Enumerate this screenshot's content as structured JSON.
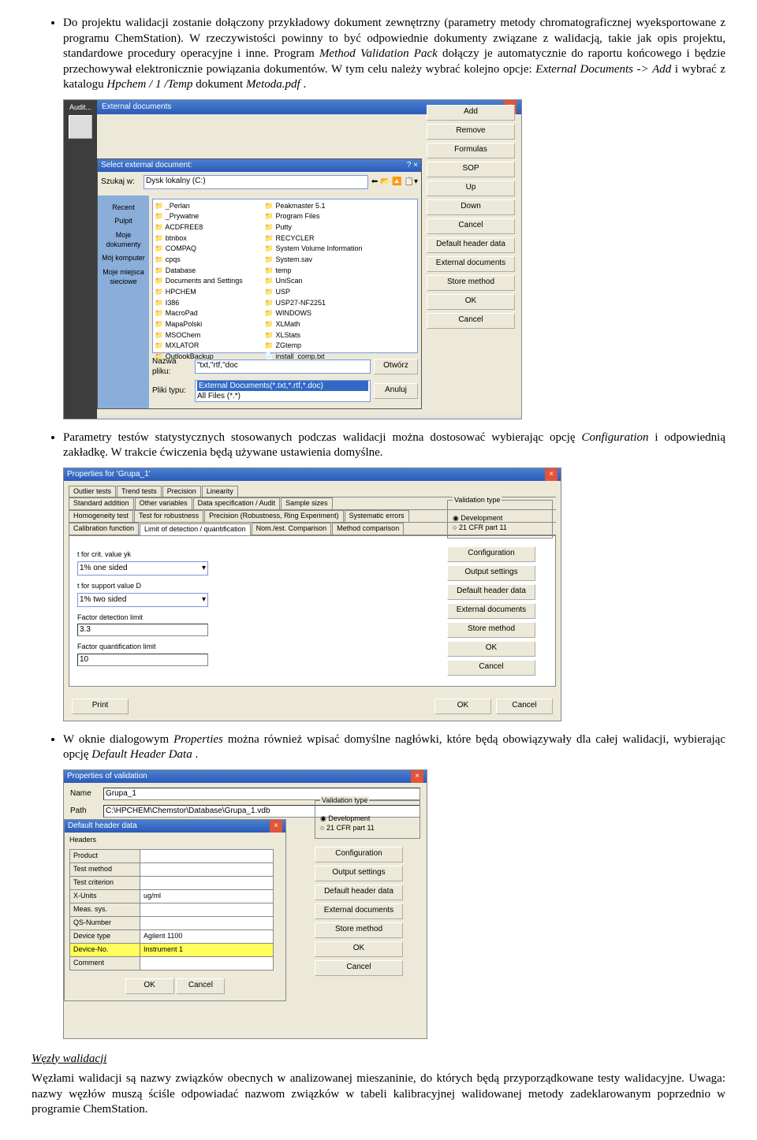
{
  "bullets": {
    "b1_part1": "Do projektu walidacji zostanie dołączony przykładowy dokument zewnętrzny (parametry metody chromatograficznej wyeksportowane z programu ChemStation). W rzeczywistości powinny to być odpowiednie dokumenty związane z walidacją, takie jak opis projektu, standardowe procedury operacyjne i inne. Program ",
    "b1_italic1": "Method Validation Pack",
    "b1_part2": " dołączy je automatycznie do raportu końcowego i będzie przechowywał elektronicznie powiązania dokumentów. W tym celu należy wybrać kolejno opcje: ",
    "b1_italic2": "External Documents -> Add",
    "b1_part3": " i wybrać z katalogu ",
    "b1_italic3": "Hpchem / 1 /Temp",
    "b1_part4": " dokument ",
    "b1_italic4": "Metoda.pdf",
    "b1_part5": ".",
    "b2_part1": "Parametry testów statystycznych stosowanych podczas walidacji można dostosować wybierając opcję ",
    "b2_italic1": "Configuration",
    "b2_part2": " i odpowiednią zakładkę. W trakcie ćwiczenia będą używane ustawienia domyślne.",
    "b3_part1": "W oknie dialogowym ",
    "b3_italic1": "Properties",
    "b3_part2": " można również wpisać domyślne nagłówki, które będą obowiązywały dla całej walidacji, wybierając opcję ",
    "b3_italic2": "Default Header Data",
    "b3_part3": "."
  },
  "section_title": "Węzły walidacji",
  "para": "Węzłami walidacji są nazwy związków obecnych w analizowanej mieszaninie, do których będą przyporządkowane testy walidacyjne. Uwaga: nazwy węzłów muszą ściśle odpowiadać nazwom związków w tabeli kalibracyjnej walidowanej metody zadeklarowanym poprzednio w programie ChemStation.",
  "ss1": {
    "audit_label": "Audit...",
    "ext_title": "External documents",
    "buttons": [
      "Add",
      "Remove",
      "Formulas",
      "SOP",
      "Up",
      "Down",
      "Cancel",
      "Default header data",
      "External documents",
      "Store method",
      "OK",
      "Cancel"
    ],
    "fd_title": "Select external document:",
    "fd_close_hint": "? ×",
    "places": [
      "Recent",
      "Pulpit",
      "Moje dokumenty",
      "Mój komputer",
      "Moje miejsca sieciowe"
    ],
    "lookin_label": "Szukaj w:",
    "lookin_value": "Dysk lokalny (C:)",
    "filename_label": "Nazwa pliku:",
    "filename_value": "\"txt,\"rtf,\"doc",
    "filetype_label": "Pliki typu:",
    "filetype_value": "External Documents(*.txt,*.rtf,*.doc)",
    "filetype_below": "All Files (*.*)",
    "open_btn": "Otwórz",
    "cancel_btn": "Anuluj",
    "col1": [
      "_Perlan",
      "_Prywatne",
      "ACDFREE8",
      "btnbox",
      "COMPAQ",
      "cpqs",
      "Database",
      "Documents and Settings",
      "HPCHEM",
      "I386",
      "MacroPad",
      "MapaPolski",
      "MSOChem",
      "MXLATOR",
      "OutlookBackup"
    ],
    "col2": [
      "Peakmaster 5.1",
      "Program Files",
      "Putty",
      "RECYCLER",
      "System Volume Information",
      "System.sav",
      "temp",
      "UniScan",
      "USP",
      "USP27-NF2251",
      "WINDOWS",
      "XLMath",
      "XLStats",
      "ZGtemp",
      "install_comp.txt"
    ]
  },
  "ss2": {
    "title": "Properties for 'Grupa_1'",
    "tab_rows": [
      [
        "Outlier tests",
        "Trend tests",
        "Precision",
        "Linearity"
      ],
      [
        "Standard addition",
        "Other variables",
        "Data specification / Audit",
        "Sample sizes"
      ],
      [
        "Homogeneity test",
        "Test for robustness",
        "Precision (Robustness, Ring Experiment)",
        "Systematic errors"
      ],
      [
        "Calibration function",
        "Limit of detection / quantification",
        "Nom./est. Comparison",
        "Method comparison"
      ]
    ],
    "active_tab": "Limit of detection / quantification",
    "field1_label": "t for crit. value yk",
    "field1_value": "1% one sided",
    "field2_label": "t for support value D",
    "field2_value": "1% two sided",
    "field3_label": "Factor detection limit",
    "field3_value": "3.3",
    "field4_label": "Factor quantification limit",
    "field4_value": "10",
    "vtype_title": "Validation type",
    "vtype_opt1": "Development",
    "vtype_opt2": "21 CFR part 11",
    "rbtns": [
      "Configuration",
      "Output settings",
      "Default header data",
      "External documents",
      "Store method",
      "OK",
      "Cancel"
    ],
    "print_btn": "Print",
    "ok_btn": "OK",
    "cancel_btn": "Cancel"
  },
  "ss3": {
    "title_outer": "Properties of validation",
    "name_label": "Name",
    "name_value": "Grupa_1",
    "path_label": "Path",
    "path_value": "C:\\HPCHEM\\Chemstor\\Database\\Grupa_1.vdb",
    "inner_title": "Default header data",
    "headers_label": "Headers",
    "rows": [
      [
        "Product",
        ""
      ],
      [
        "Test method",
        ""
      ],
      [
        "Test criterion",
        ""
      ],
      [
        "X-Units",
        "ug/ml"
      ],
      [
        "Meas. sys.",
        ""
      ],
      [
        "QS-Number",
        ""
      ],
      [
        "Device type",
        "Agilent 1100"
      ],
      [
        "Device-No.",
        "Instrument 1"
      ],
      [
        "Comment",
        ""
      ]
    ],
    "yellow_row_key": "Device-No.",
    "inner_ok": "OK",
    "inner_cancel": "Cancel",
    "vtype_title": "Validation type",
    "vtype_opt1": "Development",
    "vtype_opt2": "21 CFR part 11",
    "rbtns": [
      "Configuration",
      "Output settings",
      "Default header data",
      "External documents",
      "Store method",
      "OK",
      "Cancel"
    ]
  }
}
